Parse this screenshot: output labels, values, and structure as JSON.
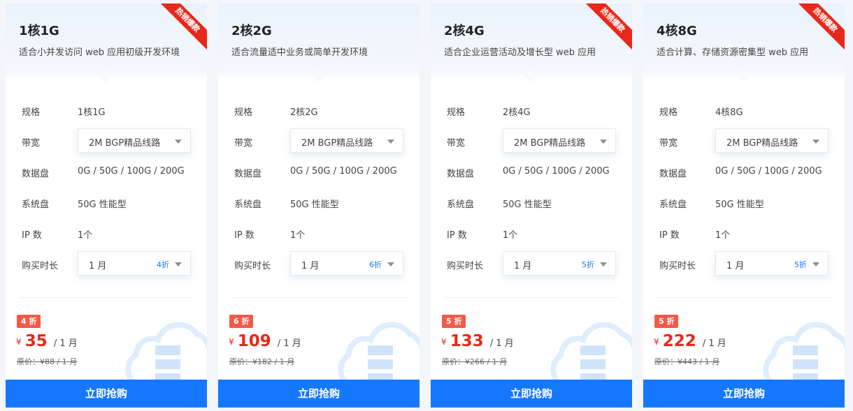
{
  "labels": {
    "spec": "规格",
    "bandwidth": "带宽",
    "data_disk": "数据盘",
    "system_disk": "系统盘",
    "ip_count": "IP 数",
    "duration": "购买时长"
  },
  "buy_label": "立即抢购",
  "ribbon_text": "热销爆款",
  "currency": "¥",
  "colors": {
    "accent": "#1677ff",
    "price": "#e8281a",
    "ribbon": "#e8281a",
    "discount_badge": "#f15a4a"
  },
  "plans": [
    {
      "title": "1核1G",
      "desc": "适合小并发访问 web 应用初级开发环境",
      "spec": "1核1G",
      "bandwidth": "2M BGP精品线路",
      "data_disk": "0G / 50G / 100G / 200G",
      "system_disk": "50G 性能型",
      "ip": "1个",
      "duration": "1 月",
      "duration_discount": "4折",
      "discount_badge": "4 折",
      "price": "35",
      "price_unit": "/ 1 月",
      "original_price": "原价：¥88 / 1 月"
    },
    {
      "title": "2核2G",
      "desc": "适合流量适中业务或简单开发环境",
      "spec": "2核2G",
      "bandwidth": "2M BGP精品线路",
      "data_disk": "0G / 50G / 100G / 200G",
      "system_disk": "50G 性能型",
      "ip": "1个",
      "duration": "1 月",
      "duration_discount": "6折",
      "discount_badge": "6 折",
      "price": "109",
      "price_unit": "/ 1 月",
      "original_price": "原价：¥182 / 1 月"
    },
    {
      "title": "2核4G",
      "desc": "适合企业运营活动及增长型 web 应用",
      "spec": "2核4G",
      "bandwidth": "2M BGP精品线路",
      "data_disk": "0G / 50G / 100G / 200G",
      "system_disk": "50G 性能型",
      "ip": "1个",
      "duration": "1 月",
      "duration_discount": "5折",
      "discount_badge": "5 折",
      "price": "133",
      "price_unit": "/ 1 月",
      "original_price": "原价：¥266 / 1 月"
    },
    {
      "title": "4核8G",
      "desc": "适合计算、存储资源密集型 web 应用",
      "spec": "4核8G",
      "bandwidth": "2M BGP精品线路",
      "data_disk": "0G / 50G / 100G / 200G",
      "system_disk": "50G 性能型",
      "ip": "1个",
      "duration": "1 月",
      "duration_discount": "5折",
      "discount_badge": "5 折",
      "price": "222",
      "price_unit": "/ 1 月",
      "original_price": "原价：¥443 / 1 月"
    }
  ]
}
